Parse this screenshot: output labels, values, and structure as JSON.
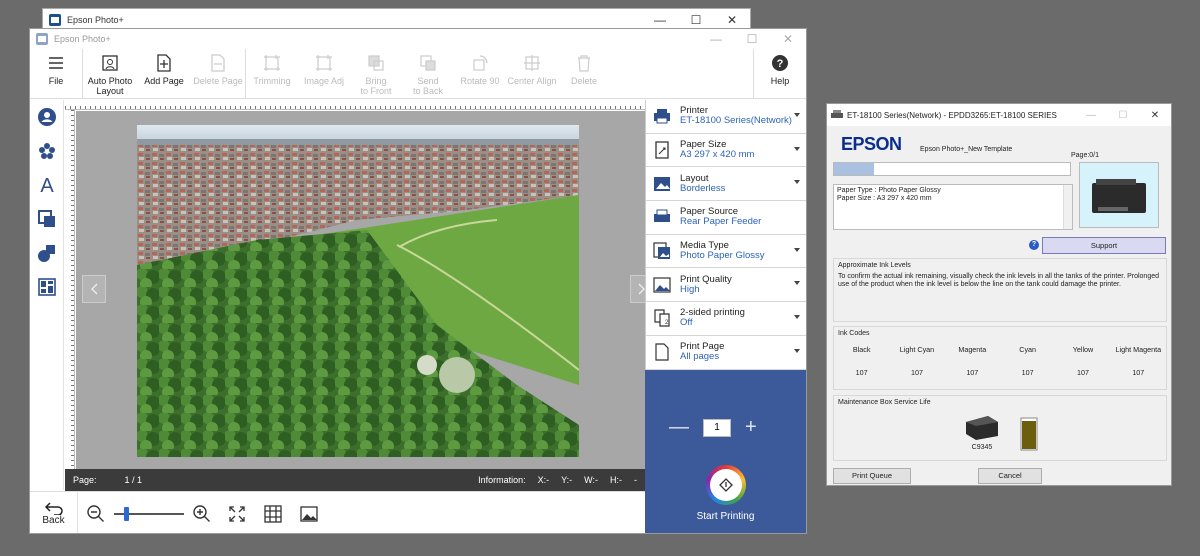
{
  "back_window": {
    "title": "Epson Photo+"
  },
  "main_window": {
    "title": "Epson Photo+"
  },
  "window_controls": {
    "min": "—",
    "max": "☐",
    "close": "✕"
  },
  "toolbar": {
    "file": "File",
    "auto_layout_1": "Auto Photo",
    "auto_layout_2": "Layout",
    "add_page": "Add Page",
    "delete_page": "Delete Page",
    "trimming": "Trimming",
    "image_adjust": "Image Adj",
    "bring_front_1": "Bring",
    "bring_front_2": "to Front",
    "send_back_1": "Send",
    "send_back_2": "to Back",
    "rotate": "Rotate 90",
    "center": "Center Align",
    "delete": "Delete",
    "help": "Help"
  },
  "statusbar": {
    "page_label": "Page:",
    "page_value": "1 / 1",
    "info_label": "Information:",
    "x": "X:-",
    "y": "Y:-",
    "w": "W:-",
    "h": "H:-",
    "dash": "-"
  },
  "bottombar": {
    "back": "Back"
  },
  "settings": [
    {
      "name": "Printer",
      "value": "ET-18100 Series(Network)",
      "icon": "printer-icon"
    },
    {
      "name": "Paper Size",
      "value": "A3 297 x 420 mm",
      "icon": "paper-size-icon"
    },
    {
      "name": "Layout",
      "value": "Borderless",
      "icon": "layout-icon"
    },
    {
      "name": "Paper Source",
      "value": "Rear Paper Feeder",
      "icon": "paper-source-icon"
    },
    {
      "name": "Media Type",
      "value": "Photo Paper Glossy",
      "icon": "media-type-icon"
    },
    {
      "name": "Print Quality",
      "value": "High",
      "icon": "print-quality-icon"
    },
    {
      "name": "2-sided printing",
      "value": "Off",
      "icon": "two-sided-icon"
    },
    {
      "name": "Print Page",
      "value": "All pages",
      "icon": "print-page-icon"
    }
  ],
  "print_panel": {
    "minus": "—",
    "plus": "+",
    "copies": "1",
    "start": "Start Printing"
  },
  "dialog": {
    "title": "ET-18100 Series(Network) - EPDD3265:ET-18100 SERIES",
    "logo": "EPSON",
    "template": "Epson Photo+_New Template",
    "page_count": "Page:0/1",
    "progress": 0.17,
    "info_line1": "Paper Type : Photo Paper Glossy",
    "info_line2": "Paper Size : A3 297 x 420 mm",
    "help": "?",
    "support": "Support",
    "approx_title": "Approximate Ink Levels",
    "approx_text": "To confirm the actual ink remaining, visually check the ink levels in all the tanks of the printer. Prolonged use of the product when the ink level is below the line on the tank could damage the printer.",
    "ink_title": "Ink Codes",
    "inks": [
      {
        "name": "Black",
        "code": "107"
      },
      {
        "name": "Light Cyan",
        "code": "107"
      },
      {
        "name": "Magenta",
        "code": "107"
      },
      {
        "name": "Cyan",
        "code": "107"
      },
      {
        "name": "Yellow",
        "code": "107"
      },
      {
        "name": "Light Magenta",
        "code": "107"
      }
    ],
    "maint_title": "Maintenance Box Service Life",
    "maint_code": "C9345",
    "print_queue": "Print Queue",
    "cancel": "Cancel"
  },
  "colors": {
    "accent": "#2c63b8",
    "print_panel": "#3c5a99",
    "epson_blue": "#0b2e8c"
  }
}
